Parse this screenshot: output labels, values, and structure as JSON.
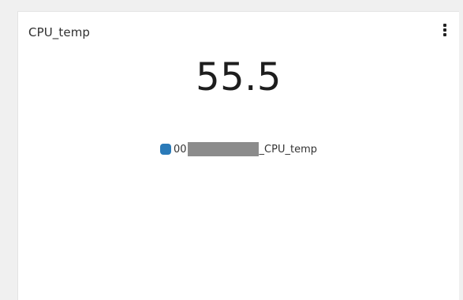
{
  "panel": {
    "title": "CPU_temp",
    "value": "55.5",
    "legend": {
      "prefix": "00",
      "suffix": "_CPU_temp",
      "color": "#2a7ab8"
    }
  },
  "icons": {
    "menu": "kebab-menu-icon"
  }
}
